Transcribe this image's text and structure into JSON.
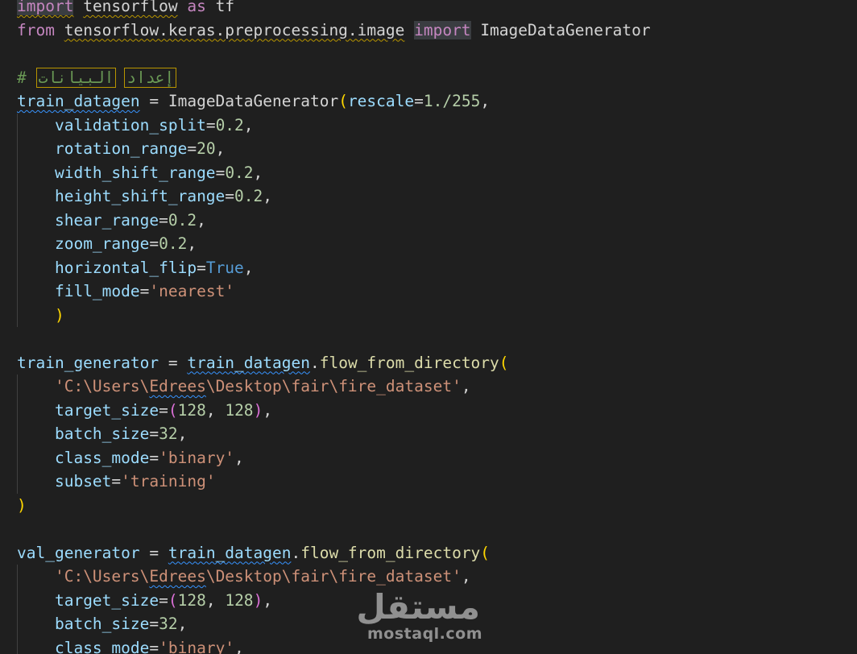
{
  "code": {
    "l1": {
      "import": "import",
      "module": "tensorflow",
      "as": " as ",
      "alias": "tf"
    },
    "l2": {
      "from": "from",
      "module": "tensorflow.keras.preprocessing.image",
      "import": "import",
      "name": "ImageDataGenerator"
    },
    "l4": {
      "hash": "#",
      "word1": "البيانات",
      "word2": "إعداد"
    },
    "l5": {
      "var": "train_datagen",
      "eq": " = ",
      "cls": "ImageDataGenerator",
      "open": "(",
      "param": "rescale",
      "eq2": "=",
      "num": "1./255",
      "comma": ","
    },
    "l6": {
      "param": "validation_split",
      "eq": "=",
      "val": "0.2",
      "comma": ","
    },
    "l7": {
      "param": "rotation_range",
      "eq": "=",
      "val": "20",
      "comma": ","
    },
    "l8": {
      "param": "width_shift_range",
      "eq": "=",
      "val": "0.2",
      "comma": ","
    },
    "l9": {
      "param": "height_shift_range",
      "eq": "=",
      "val": "0.2",
      "comma": ","
    },
    "l10": {
      "param": "shear_range",
      "eq": "=",
      "val": "0.2",
      "comma": ","
    },
    "l11": {
      "param": "zoom_range",
      "eq": "=",
      "val": "0.2",
      "comma": ","
    },
    "l12": {
      "param": "horizontal_flip",
      "eq": "=",
      "val": "True",
      "comma": ","
    },
    "l13": {
      "param": "fill_mode",
      "eq": "=",
      "val": "'nearest'"
    },
    "l14": {
      "close": ")"
    },
    "l16": {
      "var": "train_generator",
      "eq": " = ",
      "obj": "train_datagen",
      "dot": ".",
      "method": "flow_from_directory",
      "open": "("
    },
    "l17": {
      "s1": "'C:\\Users\\",
      "s2": "Edrees",
      "s3": "\\Desktop\\fair\\fire_dataset'",
      "comma": ","
    },
    "l18": {
      "param": "target_size",
      "eq": "=",
      "open": "(",
      "v1": "128",
      "sep": ", ",
      "v2": "128",
      "close": ")",
      "comma": ","
    },
    "l19": {
      "param": "batch_size",
      "eq": "=",
      "val": "32",
      "comma": ","
    },
    "l20": {
      "param": "class_mode",
      "eq": "=",
      "val": "'binary'",
      "comma": ","
    },
    "l21": {
      "param": "subset",
      "eq": "=",
      "val": "'training'"
    },
    "l22": {
      "close": ")"
    },
    "l24": {
      "var": "val_generator",
      "eq": " = ",
      "obj": "train_datagen",
      "dot": ".",
      "method": "flow_from_directory",
      "open": "("
    },
    "l25": {
      "s1": "'C:\\Users\\",
      "s2": "Edrees",
      "s3": "\\Desktop\\fair\\fire_dataset'",
      "comma": ","
    },
    "l26": {
      "param": "target_size",
      "eq": "=",
      "open": "(",
      "v1": "128",
      "sep": ", ",
      "v2": "128",
      "close": ")",
      "comma": ","
    },
    "l27": {
      "param": "batch_size",
      "eq": "=",
      "val": "32",
      "comma": ","
    },
    "l28": {
      "param": "class_mode",
      "eq": "=",
      "val": "'binary'",
      "comma": ","
    }
  },
  "watermark": {
    "arabic": "مستقل",
    "latin": "mostaql.com"
  },
  "colors": {
    "background": "#1f1f1f",
    "keyword": "#c586c0",
    "variable": "#9cdcfe",
    "function": "#dcdcaa",
    "number": "#b5cea8",
    "string": "#ce9178",
    "boolean": "#569cd6",
    "comment": "#6a9955",
    "bracket_outer": "#ffd700",
    "bracket_inner": "#da70d6"
  }
}
